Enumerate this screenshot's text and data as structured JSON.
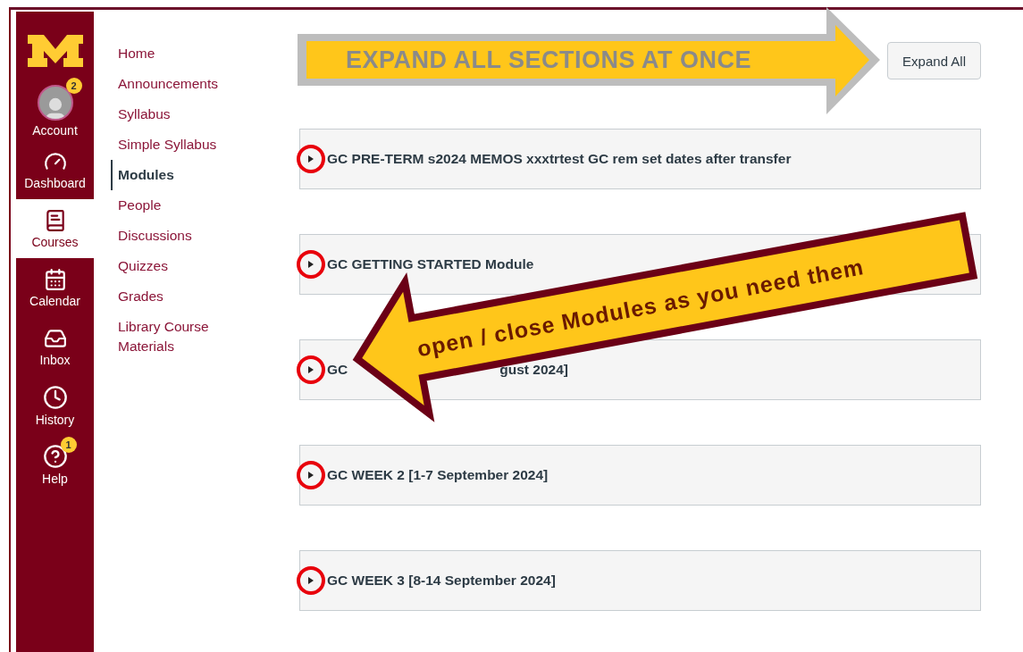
{
  "global_nav": {
    "items": [
      {
        "kind": "account",
        "label": "Account",
        "badge": "2",
        "selected": false
      },
      {
        "kind": "dashboard",
        "label": "Dashboard",
        "selected": false
      },
      {
        "kind": "courses",
        "label": "Courses",
        "selected": true
      },
      {
        "kind": "calendar",
        "label": "Calendar",
        "selected": false
      },
      {
        "kind": "inbox",
        "label": "Inbox",
        "selected": false
      },
      {
        "kind": "history",
        "label": "History",
        "selected": false
      },
      {
        "kind": "help",
        "label": "Help",
        "badge": "1",
        "selected": false
      }
    ]
  },
  "course_nav": {
    "items": [
      {
        "label": "Home",
        "selected": false
      },
      {
        "label": "Announcements",
        "selected": false
      },
      {
        "label": "Syllabus",
        "selected": false
      },
      {
        "label": "Simple Syllabus",
        "selected": false
      },
      {
        "label": "Modules",
        "selected": true
      },
      {
        "label": "People",
        "selected": false
      },
      {
        "label": "Discussions",
        "selected": false
      },
      {
        "label": "Quizzes",
        "selected": false
      },
      {
        "label": "Grades",
        "selected": false
      },
      {
        "label": "Library Course Materials",
        "selected": false
      }
    ]
  },
  "toolbar": {
    "expand_button": "Expand All"
  },
  "modules": [
    {
      "title": "GC PRE-TERM s2024 MEMOS xxxtrtest GC rem set dates after transfer",
      "expanded": false
    },
    {
      "title": "GC GETTING STARTED Module",
      "expanded": false
    },
    {
      "title": "GC",
      "title_end": "gust 2024]",
      "expanded": false
    },
    {
      "title": "GC WEEK 2 [1-7 September 2024]",
      "expanded": false
    },
    {
      "title": "GC WEEK 3 [8-14 September 2024]",
      "expanded": false
    }
  ],
  "annotations": [
    {
      "kind": "arrow_right",
      "text": "EXPAND ALL SECTIONS AT ONCE"
    },
    {
      "kind": "arrow_left",
      "text": "open / close Modules as you need them"
    }
  ]
}
